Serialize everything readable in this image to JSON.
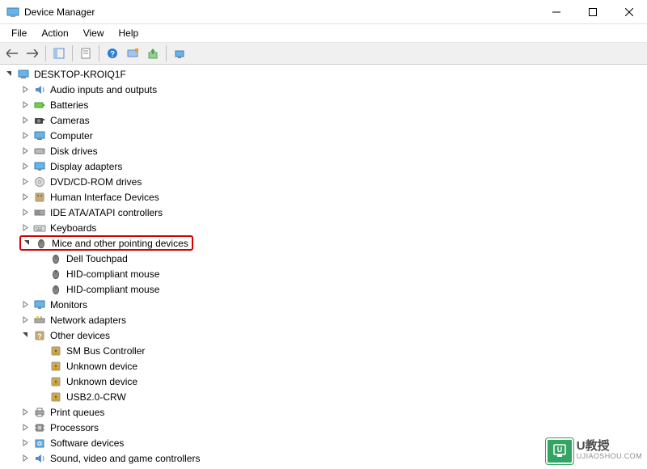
{
  "window": {
    "title": "Device Manager"
  },
  "menu": {
    "file": "File",
    "action": "Action",
    "view": "View",
    "help": "Help"
  },
  "tree": {
    "root": "DESKTOP-KROIQ1F",
    "nodes": [
      {
        "label": "Audio inputs and outputs",
        "icon": "audio"
      },
      {
        "label": "Batteries",
        "icon": "battery"
      },
      {
        "label": "Cameras",
        "icon": "camera"
      },
      {
        "label": "Computer",
        "icon": "computer"
      },
      {
        "label": "Disk drives",
        "icon": "disk"
      },
      {
        "label": "Display adapters",
        "icon": "display"
      },
      {
        "label": "DVD/CD-ROM drives",
        "icon": "dvd"
      },
      {
        "label": "Human Interface Devices",
        "icon": "hid"
      },
      {
        "label": "IDE ATA/ATAPI controllers",
        "icon": "ide"
      },
      {
        "label": "Keyboards",
        "icon": "keyboard"
      },
      {
        "label": "Mice and other pointing devices",
        "icon": "mouse",
        "expanded": true,
        "highlighted": true,
        "children": [
          {
            "label": "Dell Touchpad",
            "icon": "mouse"
          },
          {
            "label": "HID-compliant mouse",
            "icon": "mouse"
          },
          {
            "label": "HID-compliant mouse",
            "icon": "mouse"
          }
        ]
      },
      {
        "label": "Monitors",
        "icon": "monitor"
      },
      {
        "label": "Network adapters",
        "icon": "network"
      },
      {
        "label": "Other devices",
        "icon": "other",
        "expanded": true,
        "children": [
          {
            "label": "SM Bus Controller",
            "icon": "warn"
          },
          {
            "label": "Unknown device",
            "icon": "warn"
          },
          {
            "label": "Unknown device",
            "icon": "warn"
          },
          {
            "label": "USB2.0-CRW",
            "icon": "warn"
          }
        ]
      },
      {
        "label": "Print queues",
        "icon": "printer"
      },
      {
        "label": "Processors",
        "icon": "cpu"
      },
      {
        "label": "Software devices",
        "icon": "software"
      },
      {
        "label": "Sound, video and game controllers",
        "icon": "sound"
      }
    ]
  },
  "watermark": {
    "brand": "U教授",
    "url": "UJIAOSHOU.COM",
    "badge": "U"
  }
}
